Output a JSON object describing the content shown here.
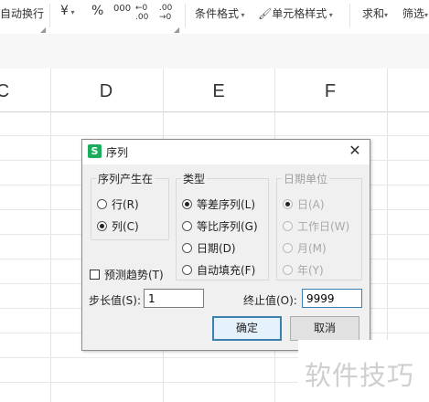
{
  "ribbon": {
    "wrap_text": "自动换行",
    "currency": "¥",
    "percent": "%",
    "thousands": "000",
    "inc_decimal": "←0 .00",
    "dec_decimal": ".00 →0",
    "conditional_format": "条件格式",
    "cell_style": "单元格样式",
    "sum": "求和",
    "filter": "筛选"
  },
  "columns": [
    "C",
    "D",
    "E",
    "F"
  ],
  "dialog": {
    "title": "序列",
    "series_in": {
      "label": "序列产生在",
      "options": [
        {
          "label": "行(R)",
          "selected": false
        },
        {
          "label": "列(C)",
          "selected": true
        }
      ]
    },
    "type": {
      "label": "类型",
      "options": [
        {
          "label": "等差序列(L)",
          "selected": true
        },
        {
          "label": "等比序列(G)",
          "selected": false
        },
        {
          "label": "日期(D)",
          "selected": false
        },
        {
          "label": "自动填充(F)",
          "selected": false
        }
      ]
    },
    "date_unit": {
      "label": "日期单位",
      "options": [
        {
          "label": "日(A)",
          "selected": true
        },
        {
          "label": "工作日(W)",
          "selected": false
        },
        {
          "label": "月(M)",
          "selected": false
        },
        {
          "label": "年(Y)",
          "selected": false
        }
      ]
    },
    "trend_label": "预测趋势(T)",
    "step_label": "步长值(S):",
    "step_value": "1",
    "stop_label": "终止值(O):",
    "stop_value": "9999",
    "ok": "确定",
    "cancel": "取消"
  },
  "watermark": "软件技巧"
}
